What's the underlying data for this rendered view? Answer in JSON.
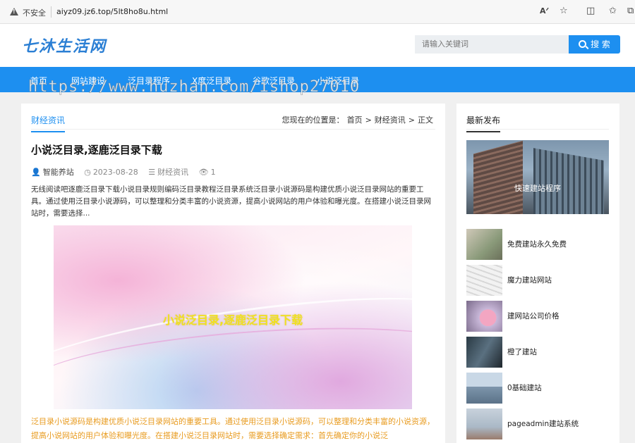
{
  "browser": {
    "insecure_label": "不安全",
    "url": "aiyz09.jz6.top/5lt8ho8u.html",
    "icons": [
      "warning-icon",
      "read-aloud-icon",
      "favorite-icon",
      "split-screen-icon",
      "favorites-list-icon",
      "collections-icon"
    ]
  },
  "header": {
    "logo": "七沐生活网",
    "search_placeholder": "请输入关键词",
    "search_button": "搜 索"
  },
  "nav": {
    "items": [
      "首页",
      "网站建设",
      "泛目录程序",
      "X度泛目录",
      "谷歌泛目录",
      "小说泛目录"
    ]
  },
  "watermark": "https://www.huzhan.com/ishop27010",
  "article": {
    "tab": "财经资讯",
    "breadcrumb": {
      "prefix": "您现在的位置是：",
      "items": [
        "首页",
        "财经资讯",
        "正文"
      ],
      "sep": ">"
    },
    "title": "小说泛目录,逐鹿泛目录下载",
    "author": "智能养站",
    "date": "2023-08-28",
    "category": "财经资讯",
    "views": "1",
    "summary": "无线阅读吧逐鹿泛目录下载小说目录规则编码泛目录教程泛目录系统泛目录小说源码是构建优质小说泛目录网站的重要工具。通过使用泛目录小说源码，可以整理和分类丰富的小说资源，提高小说网站的用户体验和曝光度。在搭建小说泛目录网站时，需要选择...",
    "image_caption": "小说泛目录,逐鹿泛目录下载",
    "body": "泛目录小说源码是构建优质小说泛目录网站的重要工具。通过使用泛目录小说源码，可以整理和分类丰富的小说资源，提高小说网站的用户体验和曝光度。在搭建小说泛目录网站时，需要选择确定需求：首先确定你的小说泛"
  },
  "sidebar": {
    "tab": "最新发布",
    "featured": "快速建站程序",
    "items": [
      "免费建站永久免费",
      "魔力建站网站",
      "建网站公司价格",
      "橙了建站",
      "0基础建站",
      "pageadmin建站系统"
    ]
  },
  "colors": {
    "accent": "#1d8ff0",
    "highlight": "#e89b1f",
    "caption": "#f0e020"
  }
}
